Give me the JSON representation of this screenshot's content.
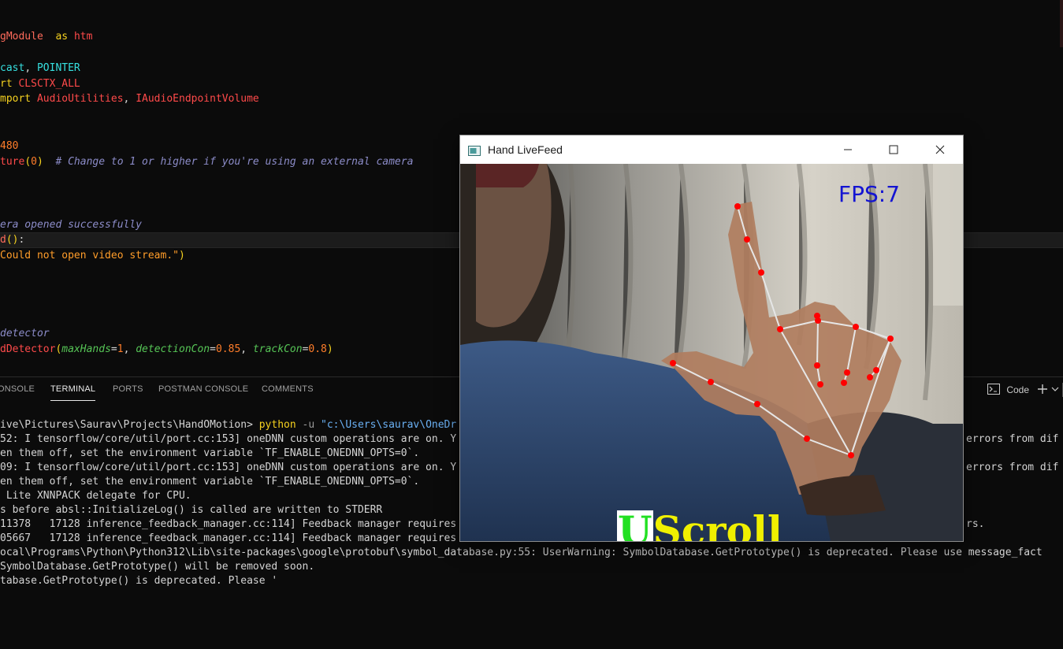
{
  "editor": {
    "lines": [
      {
        "parts": [
          [
            "kw-mod",
            "gModule"
          ],
          [
            "",
            "  "
          ],
          [
            "kw",
            "as"
          ],
          [
            "",
            " "
          ],
          [
            "red",
            "htm"
          ]
        ]
      },
      {
        "parts": [
          [
            "cls",
            "cast"
          ],
          [
            "",
            ", "
          ],
          [
            "cls",
            "POINTER"
          ]
        ]
      },
      {
        "parts": [
          [
            "kw",
            "rt"
          ],
          [
            "",
            " "
          ],
          [
            "red",
            "CLSCTX_ALL"
          ]
        ]
      },
      {
        "parts": [
          [
            "kw",
            "mport"
          ],
          [
            "",
            " "
          ],
          [
            "red",
            "AudioUtilities"
          ],
          [
            "",
            ", "
          ],
          [
            "red",
            "IAudioEndpointVolume"
          ]
        ]
      },
      {
        "parts": [
          [
            "num",
            "480"
          ]
        ]
      },
      {
        "parts": [
          [
            "red",
            "ture"
          ],
          [
            "paren",
            "("
          ],
          [
            "num",
            "0"
          ],
          [
            "paren",
            ")"
          ],
          [
            "",
            " "
          ],
          [
            "cmt",
            " # Change to 1 or higher if you're using an external camera"
          ]
        ]
      },
      {
        "parts": [
          [
            "cmt",
            "era opened successfully"
          ]
        ]
      },
      {
        "parts": [
          [
            "kw-mod",
            "d"
          ],
          [
            "paren",
            "()"
          ],
          [
            "",
            ":"
          ]
        ]
      },
      {
        "parts": [
          [
            "str",
            "Could not open video stream.\""
          ],
          [
            "paren",
            ")"
          ]
        ]
      },
      {
        "parts": [
          [
            "cmt",
            "detector"
          ]
        ]
      },
      {
        "parts": [
          [
            "red",
            "dDetector"
          ],
          [
            "paren",
            "("
          ],
          [
            "param",
            "maxHands"
          ],
          [
            "",
            "="
          ],
          [
            "num",
            "1"
          ],
          [
            "",
            ", "
          ],
          [
            "param",
            "detectionCon"
          ],
          [
            "",
            "="
          ],
          [
            "num",
            "0.85"
          ],
          [
            "",
            ", "
          ],
          [
            "param",
            "trackCon"
          ],
          [
            "",
            "="
          ],
          [
            "num",
            "0.8"
          ],
          [
            "paren",
            ")"
          ]
        ]
      }
    ]
  },
  "panel": {
    "tabs": [
      "ONSOLE",
      "TERMINAL",
      "PORTS",
      "POSTMAN CONSOLE",
      "COMMENTS"
    ],
    "active_tab": "TERMINAL",
    "terminal_profile": "Code"
  },
  "terminal": {
    "prompt": "ive\\Pictures\\Saurav\\Projects\\HandOMotion> ",
    "cmd": "python",
    "arg": " -u ",
    "path": "\"c:\\Users\\saurav\\OneDr",
    "lines": [
      "52: I tensorflow/core/util/port.cc:153] oneDNN custom operations are on. Y",
      "en them off, set the environment variable `TF_ENABLE_ONEDNN_OPTS=0`.",
      "09: I tensorflow/core/util/port.cc:153] oneDNN custom operations are on. Y",
      "en them off, set the environment variable `TF_ENABLE_ONEDNN_OPTS=0`.",
      " Lite XNNPACK delegate for CPU.",
      "s before absl::InitializeLog() is called are written to STDERR",
      "11378   17128 inference_feedback_manager.cc:114] Feedback manager requires",
      "05667   17128 inference_feedback_manager.cc:114] Feedback manager requires",
      "ocal\\Programs\\Python\\Python312\\Lib\\site-packages\\google\\protobuf\\symbol_database.py:55: UserWarning: SymbolDatabase.GetPrototype() is deprecated. Please use message_fact",
      "SymbolDatabase.GetPrototype() will be removed soon.",
      "tabase.GetPrototype() is deprecated. Please '"
    ],
    "right_fragments": [
      "errors from dif",
      "errors from dif",
      "rs.",
      ""
    ]
  },
  "window": {
    "title": "Hand LiveFeed",
    "fps_text": "FPS:7",
    "mode_first": "U",
    "mode_rest": "Scroll"
  },
  "colors": {
    "fps": "#1414d2",
    "landmark": "#ff0000",
    "mode_first": "#22e022",
    "mode_rest": "#f0f000"
  }
}
